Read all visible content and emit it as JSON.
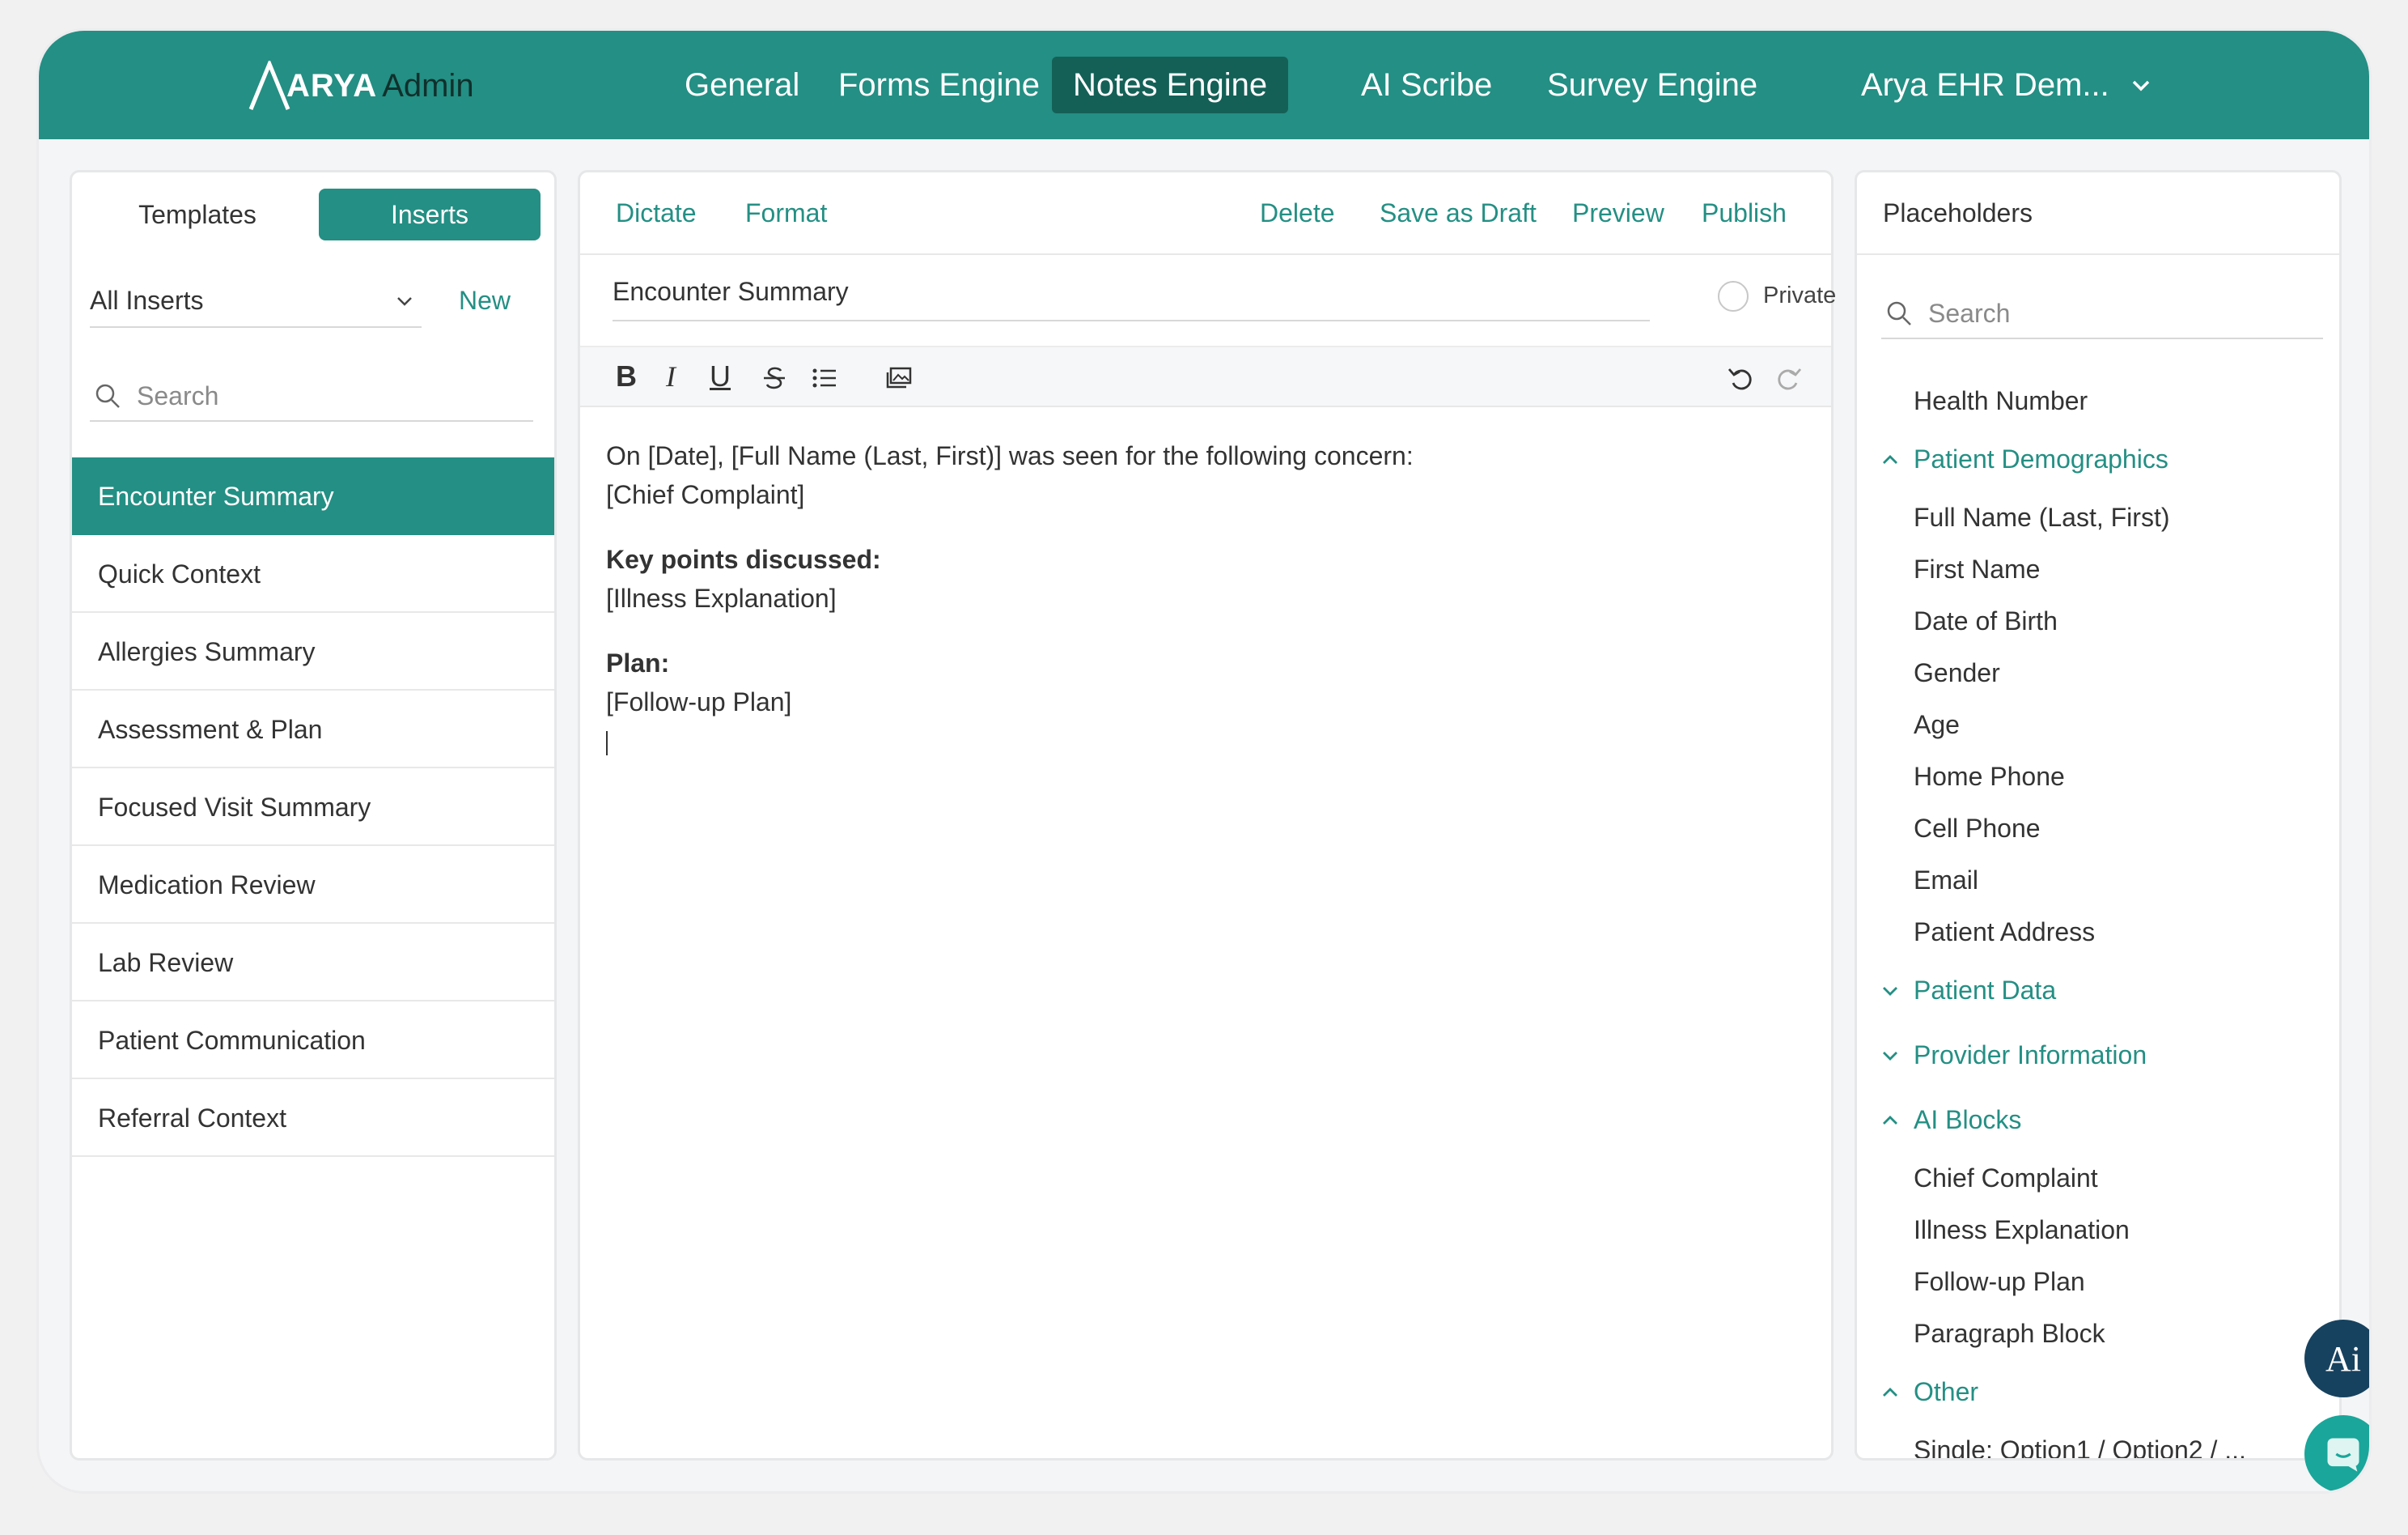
{
  "app": {
    "brand": "ARYA",
    "brand_suffix": "Admin"
  },
  "nav": {
    "items": [
      "General",
      "Forms Engine",
      "Notes Engine",
      "AI Scribe",
      "Survey Engine"
    ],
    "active": "Notes Engine",
    "org": "Arya EHR Dem..."
  },
  "left": {
    "tabs": {
      "templates": "Templates",
      "inserts": "Inserts"
    },
    "filter": "All Inserts",
    "new_label": "New",
    "search_placeholder": "Search",
    "items": [
      "Encounter Summary",
      "Quick Context",
      "Allergies Summary",
      "Assessment & Plan",
      "Focused Visit Summary",
      "Medication Review",
      "Lab Review",
      "Patient Communication",
      "Referral Context"
    ],
    "active_item": "Encounter Summary"
  },
  "editor": {
    "actions": {
      "dictate": "Dictate",
      "format": "Format",
      "delete": "Delete",
      "save_draft": "Save as Draft",
      "preview": "Preview",
      "publish": "Publish"
    },
    "title": "Encounter Summary",
    "private_label": "Private",
    "toolbar": {
      "bold": "B",
      "italic": "I",
      "underline": "U"
    },
    "body": {
      "line1": "On [Date], [Full Name (Last, First)] was seen for the following concern:",
      "line2": "[Chief Complaint]",
      "heading1": "Key points discussed:",
      "line3": "[Illness Explanation]",
      "heading2": "Plan:",
      "line4": "[Follow-up Plan]"
    }
  },
  "placeholders": {
    "title": "Placeholders",
    "search_placeholder": "Search",
    "top_item": "Health Number",
    "groups": {
      "demographics": {
        "label": "Patient Demographics",
        "items": [
          "Full Name (Last, First)",
          "First Name",
          "Date of Birth",
          "Gender",
          "Age",
          "Home Phone",
          "Cell Phone",
          "Email",
          "Patient Address"
        ]
      },
      "patient_data": {
        "label": "Patient Data"
      },
      "provider": {
        "label": "Provider Information"
      },
      "ai_blocks": {
        "label": "AI Blocks",
        "items": [
          "Chief Complaint",
          "Illness Explanation",
          "Follow-up Plan",
          "Paragraph Block"
        ]
      },
      "other": {
        "label": "Other",
        "items": [
          "Single: Option1 / Option2 / ..."
        ]
      }
    }
  },
  "fab": {
    "ai_label": "Ai"
  },
  "colors": {
    "accent": "#248f84",
    "accent_dark": "#146057",
    "ai_fab": "#17425f"
  }
}
